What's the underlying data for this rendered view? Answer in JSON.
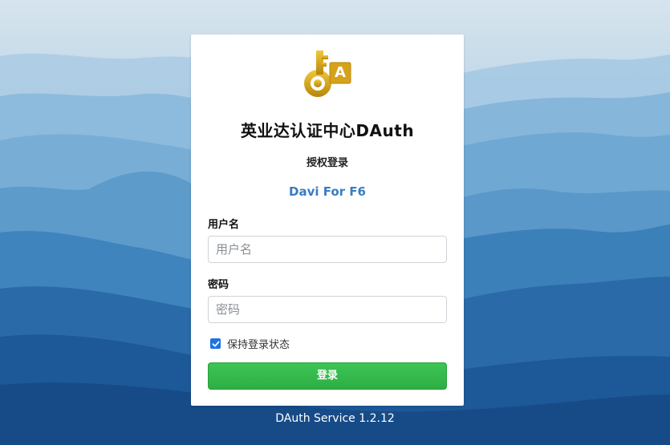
{
  "brand": {
    "logo_icon": "key-letter-a-icon",
    "logo_letter": "A",
    "title": "英业达认证中心DAuth",
    "subtitle": "授权登录",
    "app_name": "Davi For F6"
  },
  "form": {
    "username_label": "用户名",
    "username_placeholder": "用户名",
    "password_label": "密码",
    "password_placeholder": "密码",
    "remember_label": "保持登录状态",
    "remember_checked": true,
    "submit_label": "登录"
  },
  "footer": {
    "service_text": "DAuth Service 1.2.12"
  },
  "colors": {
    "accent_blue": "#3a7cc1",
    "button_green": "#34b84c",
    "checkbox_blue": "#1a73e8",
    "logo_gold": "#d6a21a"
  }
}
